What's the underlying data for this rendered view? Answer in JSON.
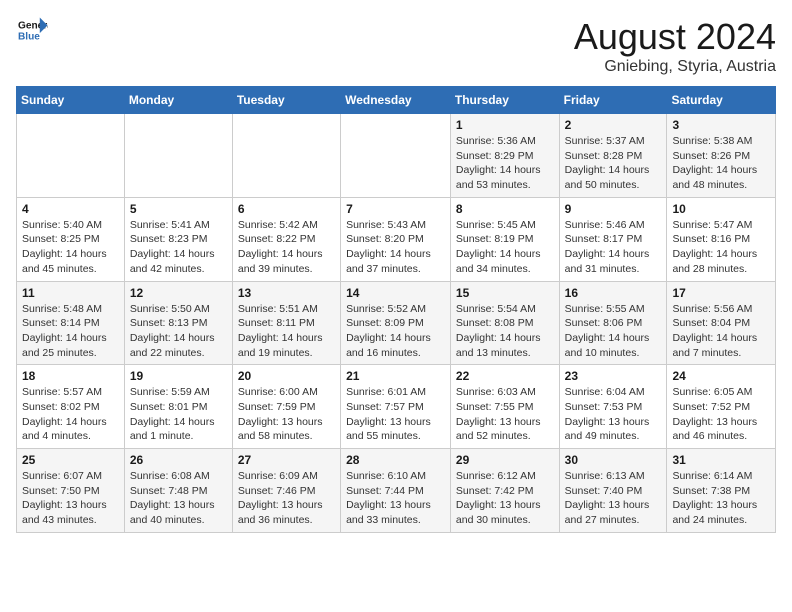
{
  "header": {
    "logo_line1": "General",
    "logo_line2": "Blue",
    "month": "August 2024",
    "location": "Gniebing, Styria, Austria"
  },
  "days_of_week": [
    "Sunday",
    "Monday",
    "Tuesday",
    "Wednesday",
    "Thursday",
    "Friday",
    "Saturday"
  ],
  "weeks": [
    [
      {
        "day": "",
        "info": ""
      },
      {
        "day": "",
        "info": ""
      },
      {
        "day": "",
        "info": ""
      },
      {
        "day": "",
        "info": ""
      },
      {
        "day": "1",
        "info": "Sunrise: 5:36 AM\nSunset: 8:29 PM\nDaylight: 14 hours\nand 53 minutes."
      },
      {
        "day": "2",
        "info": "Sunrise: 5:37 AM\nSunset: 8:28 PM\nDaylight: 14 hours\nand 50 minutes."
      },
      {
        "day": "3",
        "info": "Sunrise: 5:38 AM\nSunset: 8:26 PM\nDaylight: 14 hours\nand 48 minutes."
      }
    ],
    [
      {
        "day": "4",
        "info": "Sunrise: 5:40 AM\nSunset: 8:25 PM\nDaylight: 14 hours\nand 45 minutes."
      },
      {
        "day": "5",
        "info": "Sunrise: 5:41 AM\nSunset: 8:23 PM\nDaylight: 14 hours\nand 42 minutes."
      },
      {
        "day": "6",
        "info": "Sunrise: 5:42 AM\nSunset: 8:22 PM\nDaylight: 14 hours\nand 39 minutes."
      },
      {
        "day": "7",
        "info": "Sunrise: 5:43 AM\nSunset: 8:20 PM\nDaylight: 14 hours\nand 37 minutes."
      },
      {
        "day": "8",
        "info": "Sunrise: 5:45 AM\nSunset: 8:19 PM\nDaylight: 14 hours\nand 34 minutes."
      },
      {
        "day": "9",
        "info": "Sunrise: 5:46 AM\nSunset: 8:17 PM\nDaylight: 14 hours\nand 31 minutes."
      },
      {
        "day": "10",
        "info": "Sunrise: 5:47 AM\nSunset: 8:16 PM\nDaylight: 14 hours\nand 28 minutes."
      }
    ],
    [
      {
        "day": "11",
        "info": "Sunrise: 5:48 AM\nSunset: 8:14 PM\nDaylight: 14 hours\nand 25 minutes."
      },
      {
        "day": "12",
        "info": "Sunrise: 5:50 AM\nSunset: 8:13 PM\nDaylight: 14 hours\nand 22 minutes."
      },
      {
        "day": "13",
        "info": "Sunrise: 5:51 AM\nSunset: 8:11 PM\nDaylight: 14 hours\nand 19 minutes."
      },
      {
        "day": "14",
        "info": "Sunrise: 5:52 AM\nSunset: 8:09 PM\nDaylight: 14 hours\nand 16 minutes."
      },
      {
        "day": "15",
        "info": "Sunrise: 5:54 AM\nSunset: 8:08 PM\nDaylight: 14 hours\nand 13 minutes."
      },
      {
        "day": "16",
        "info": "Sunrise: 5:55 AM\nSunset: 8:06 PM\nDaylight: 14 hours\nand 10 minutes."
      },
      {
        "day": "17",
        "info": "Sunrise: 5:56 AM\nSunset: 8:04 PM\nDaylight: 14 hours\nand 7 minutes."
      }
    ],
    [
      {
        "day": "18",
        "info": "Sunrise: 5:57 AM\nSunset: 8:02 PM\nDaylight: 14 hours\nand 4 minutes."
      },
      {
        "day": "19",
        "info": "Sunrise: 5:59 AM\nSunset: 8:01 PM\nDaylight: 14 hours\nand 1 minute."
      },
      {
        "day": "20",
        "info": "Sunrise: 6:00 AM\nSunset: 7:59 PM\nDaylight: 13 hours\nand 58 minutes."
      },
      {
        "day": "21",
        "info": "Sunrise: 6:01 AM\nSunset: 7:57 PM\nDaylight: 13 hours\nand 55 minutes."
      },
      {
        "day": "22",
        "info": "Sunrise: 6:03 AM\nSunset: 7:55 PM\nDaylight: 13 hours\nand 52 minutes."
      },
      {
        "day": "23",
        "info": "Sunrise: 6:04 AM\nSunset: 7:53 PM\nDaylight: 13 hours\nand 49 minutes."
      },
      {
        "day": "24",
        "info": "Sunrise: 6:05 AM\nSunset: 7:52 PM\nDaylight: 13 hours\nand 46 minutes."
      }
    ],
    [
      {
        "day": "25",
        "info": "Sunrise: 6:07 AM\nSunset: 7:50 PM\nDaylight: 13 hours\nand 43 minutes."
      },
      {
        "day": "26",
        "info": "Sunrise: 6:08 AM\nSunset: 7:48 PM\nDaylight: 13 hours\nand 40 minutes."
      },
      {
        "day": "27",
        "info": "Sunrise: 6:09 AM\nSunset: 7:46 PM\nDaylight: 13 hours\nand 36 minutes."
      },
      {
        "day": "28",
        "info": "Sunrise: 6:10 AM\nSunset: 7:44 PM\nDaylight: 13 hours\nand 33 minutes."
      },
      {
        "day": "29",
        "info": "Sunrise: 6:12 AM\nSunset: 7:42 PM\nDaylight: 13 hours\nand 30 minutes."
      },
      {
        "day": "30",
        "info": "Sunrise: 6:13 AM\nSunset: 7:40 PM\nDaylight: 13 hours\nand 27 minutes."
      },
      {
        "day": "31",
        "info": "Sunrise: 6:14 AM\nSunset: 7:38 PM\nDaylight: 13 hours\nand 24 minutes."
      }
    ]
  ]
}
